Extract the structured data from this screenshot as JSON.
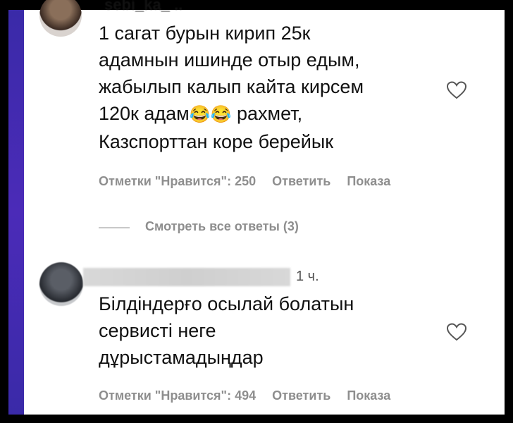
{
  "comments": [
    {
      "username": "sebi_ka_ ..",
      "text_line1": "1 сагат бурын кирип 25к",
      "text_line2": "адамнын ишинде отыр едым,",
      "text_line3": "жабылып калып кайта кирсем",
      "text_line4_a": "120к адам",
      "emoji": "😂😂",
      "text_line4_b": "рахмет,",
      "text_line5": "Казспорттан коре берейык",
      "likes_label": "Отметки \"Нравится\": 250",
      "reply_label": "Ответить",
      "show_label": "Показа",
      "view_replies": "Смотреть все ответы (3)",
      "heart_icon": "heart-outline-icon"
    },
    {
      "time": "1 ч.",
      "text_line1": "Білдіндерғо осылай болатын",
      "text_line2": "сервисті неге",
      "text_line3": "дұрыстамадыңдар",
      "likes_label": "Отметки \"Нравится\": 494",
      "reply_label": "Ответить",
      "show_label": "Показа",
      "heart_icon": "heart-outline-icon"
    }
  ],
  "colors": {
    "side_bar": "#3a2aa8",
    "meta_text": "#8e8e8e",
    "text": "#111111"
  }
}
